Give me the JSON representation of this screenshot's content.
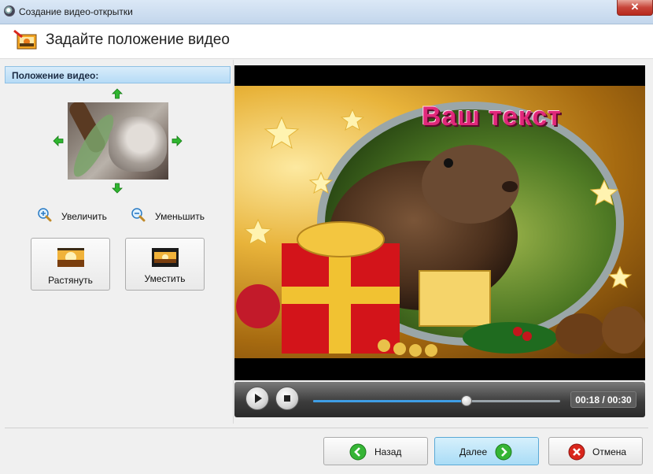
{
  "window": {
    "title": "Создание видео-открытки",
    "close_glyph": "✕"
  },
  "header": {
    "title": "Задайте положение видео",
    "icon": "film-image-icon"
  },
  "left_panel": {
    "section_title": "Положение видео:",
    "zoom_in_label": "Увеличить",
    "zoom_out_label": "Уменьшить",
    "stretch_label": "Растянуть",
    "fit_label": "Уместить"
  },
  "video": {
    "overlay_text": "Ваш текст",
    "time_display": "00:18 / 00:30",
    "progress_fraction": 0.62
  },
  "footer": {
    "back_label": "Назад",
    "next_label": "Далее",
    "cancel_label": "Отмена"
  },
  "colors": {
    "accent_blue": "#3f9ee6",
    "arrow_green": "#2fb52f",
    "cancel_red": "#d9261c",
    "overlay_text": "#e0287a"
  }
}
